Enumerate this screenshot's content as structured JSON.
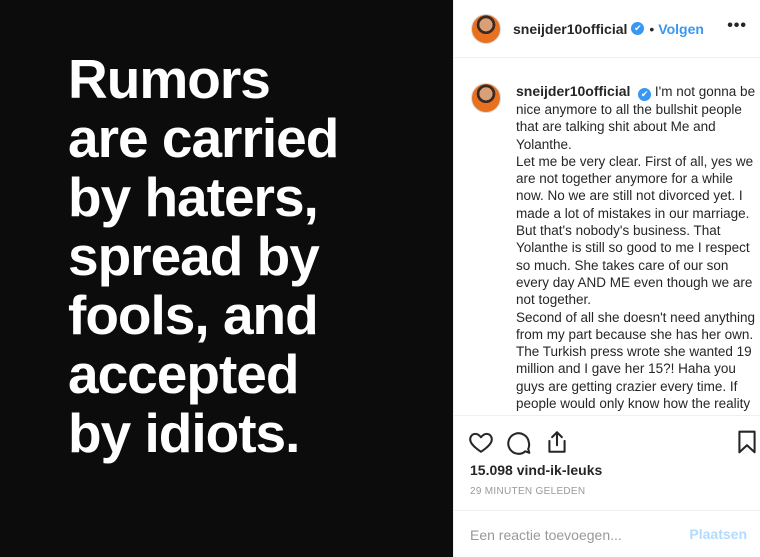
{
  "image": {
    "quote_lines": [
      "Rumors",
      "are carried",
      "by haters,",
      "spread by",
      "fools, and",
      "accepted",
      "by idiots."
    ]
  },
  "header": {
    "username": "sneijder10official",
    "verified_glyph": "✔",
    "separator": "•",
    "follow_label": "Volgen",
    "more_label": "•••"
  },
  "caption": {
    "username": "sneijder10official",
    "paragraphs": [
      "I'm not gonna be nice anymore to all the bullshit people that are talking shit about Me and Yolanthe.",
      "Let me be very clear. First of all, yes we are not together anymore for a while now. No we are still not divorced yet. I made a lot of mistakes in our marriage. But that's nobody's business. That Yolanthe is still so good to me I respect so much. She takes care of our son every day AND ME even though we are not together.",
      "Second of all she doesn't need anything from my part because she has her own.",
      "The Turkish press wrote she wanted 19 million and I gave her 15?! Haha you guys are getting crazier every time. If people would only know how the reality"
    ]
  },
  "actions": {
    "icons": [
      "heart-icon",
      "comment-icon",
      "share-icon",
      "bookmark-icon"
    ]
  },
  "likes": "15.098 vind-ik-leuks",
  "timestamp": "29 MINUTEN GELEDEN",
  "comment": {
    "placeholder": "Een reactie toevoegen...",
    "post_label": "Plaatsen"
  },
  "colors": {
    "accent": "#3897f0",
    "post_disabled": "#b3dbff",
    "image_bg": "#0c0c0c"
  }
}
